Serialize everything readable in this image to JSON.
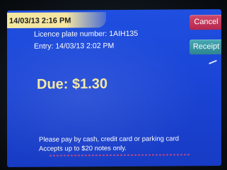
{
  "clock": "14/03/13 2:16 PM",
  "ticket": {
    "plate_line": "Licence plate number: 1AIH135",
    "entry_line": "Entry: 14/03/13 2:02 PM"
  },
  "due": "Due: $1.30",
  "buttons": {
    "cancel": "Cancel",
    "receipt": "Receipt"
  },
  "footer": {
    "line1": "Please pay by cash, credit card or parking card",
    "line2": "Accepts up to $20 notes only."
  },
  "colors": {
    "screen": "#1f4fe0",
    "clock_bar": "#f4e7a0",
    "due_text": "#f4e79e",
    "cancel": "#c23a5d",
    "receipt": "#3b97a2"
  }
}
